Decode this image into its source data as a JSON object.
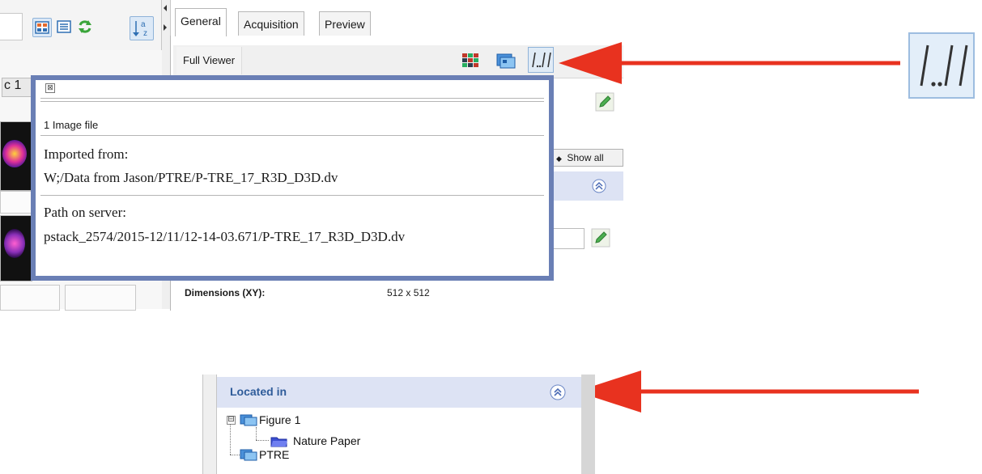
{
  "left_panel": {
    "tab_label": "c 1"
  },
  "tabs": [
    {
      "label": "General",
      "active": true
    },
    {
      "label": "Acquisition",
      "active": false
    },
    {
      "label": "Preview",
      "active": false
    }
  ],
  "viewer": {
    "full_viewer_label": "Full Viewer"
  },
  "filter": {
    "show_all_label": "Show all"
  },
  "metadata": {
    "dimensions_label": "Dimensions (XY):",
    "dimensions_value": "512 x 512"
  },
  "popup": {
    "close_glyph": "⊠",
    "count_label": "1 Image file",
    "imported_label": "Imported from:",
    "imported_value": "W;/Data from Jason/PTRE/P-TRE_17_R3D_D3D.dv",
    "path_label": "Path on server:",
    "path_value": "pstack_2574/2015-12/11/12-14-03.671/P-TRE_17_R3D_D3D.dv"
  },
  "zoom_icon": {
    "glyph": "/../."
  },
  "located_in": {
    "title": "Located in",
    "tree": [
      {
        "label": "Figure 1",
        "level": 0,
        "type": "dataset",
        "expander": "⊟"
      },
      {
        "label": "Nature Paper",
        "level": 1,
        "type": "project"
      },
      {
        "label": "PTRE",
        "level": 0,
        "type": "dataset"
      }
    ]
  },
  "colors": {
    "arrow": "#e8321f",
    "popup_border": "#6a7fb5",
    "section_bg": "#dde3f4",
    "title_blue": "#2f5c9a"
  }
}
